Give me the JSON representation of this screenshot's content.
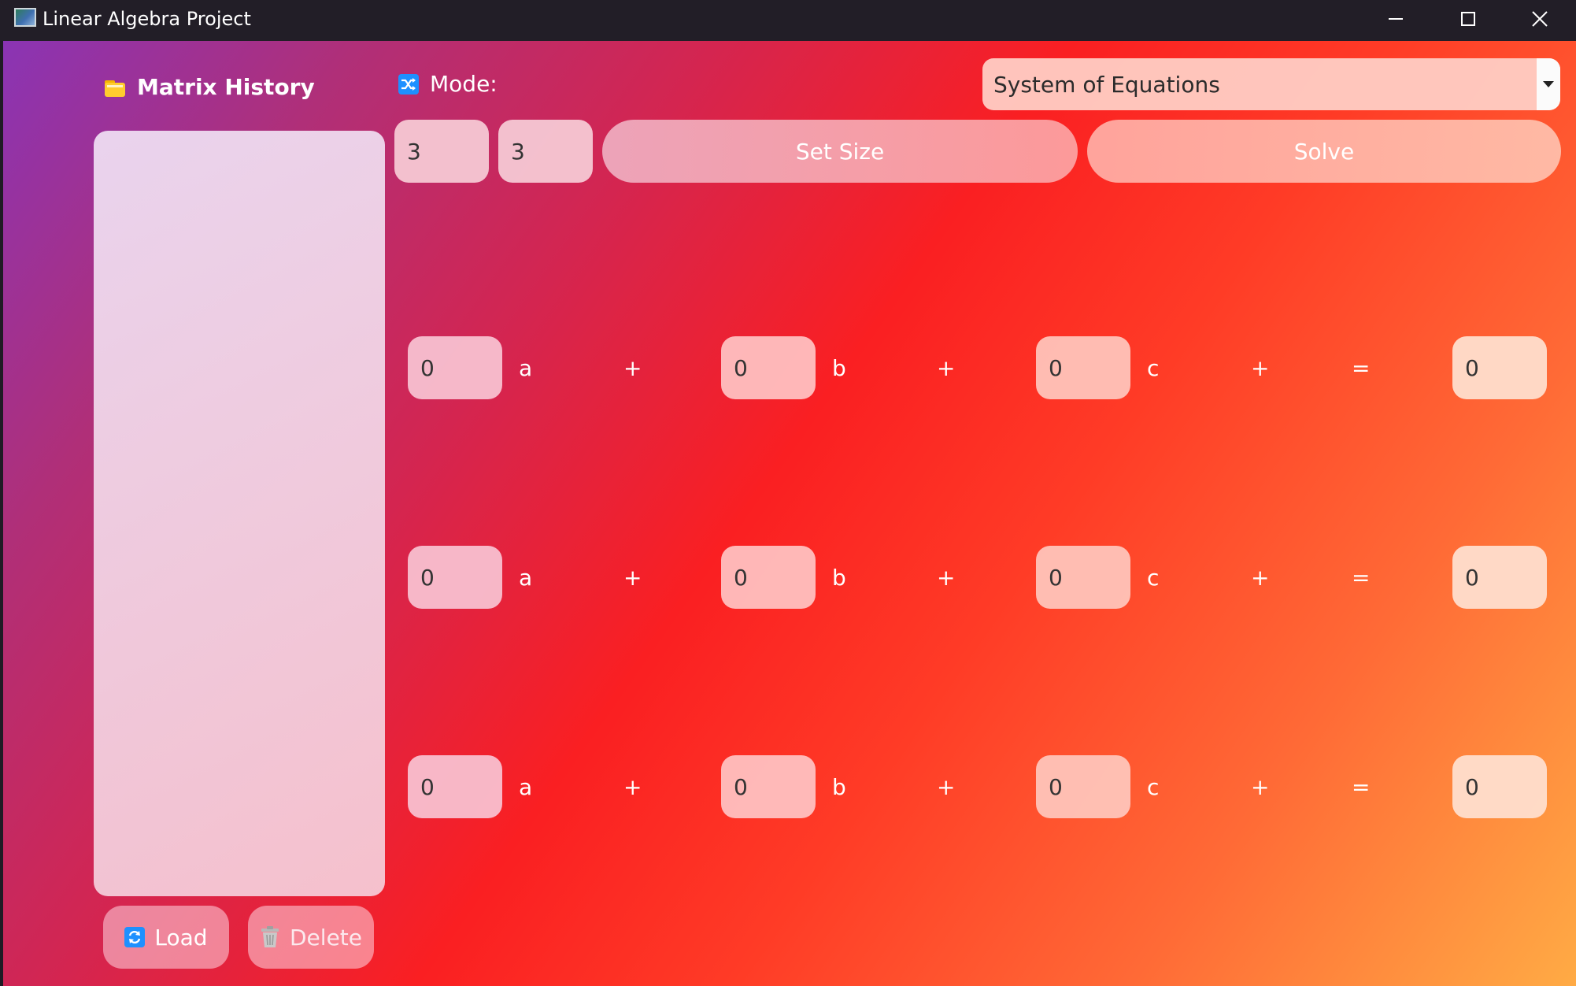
{
  "window": {
    "title": "Linear Algebra Project"
  },
  "history": {
    "title": "Matrix History",
    "items": [],
    "load_label": "Load",
    "delete_label": "Delete"
  },
  "mode": {
    "label": "Mode:",
    "selected": "System of Equations"
  },
  "size": {
    "rows": "3",
    "cols": "3",
    "set_size_label": "Set Size",
    "solve_label": "Solve"
  },
  "equations": [
    {
      "coef_a": "0",
      "var_a": "a",
      "plus1": "+",
      "coef_b": "0",
      "var_b": "b",
      "plus2": "+",
      "coef_c": "0",
      "var_c": "c",
      "plus3": "+",
      "equals": "=",
      "rhs": "0"
    },
    {
      "coef_a": "0",
      "var_a": "a",
      "plus1": "+",
      "coef_b": "0",
      "var_b": "b",
      "plus2": "+",
      "coef_c": "0",
      "var_c": "c",
      "plus3": "+",
      "equals": "=",
      "rhs": "0"
    },
    {
      "coef_a": "0",
      "var_a": "a",
      "plus1": "+",
      "coef_b": "0",
      "var_b": "b",
      "plus2": "+",
      "coef_c": "0",
      "var_c": "c",
      "plus3": "+",
      "equals": "=",
      "rhs": "0"
    }
  ],
  "icons": {
    "app": "app-window-icon",
    "history": "folder-icon",
    "mode": "shuffle-icon",
    "load": "refresh-icon",
    "delete": "trash-icon",
    "select": "chevron-down-icon"
  },
  "colors": {
    "gradient_start": "#8a34b4",
    "gradient_mid": "#fa1f22",
    "gradient_end": "#ffab45",
    "titlebar": "#221e27",
    "accent_blue": "#1e90ff"
  }
}
